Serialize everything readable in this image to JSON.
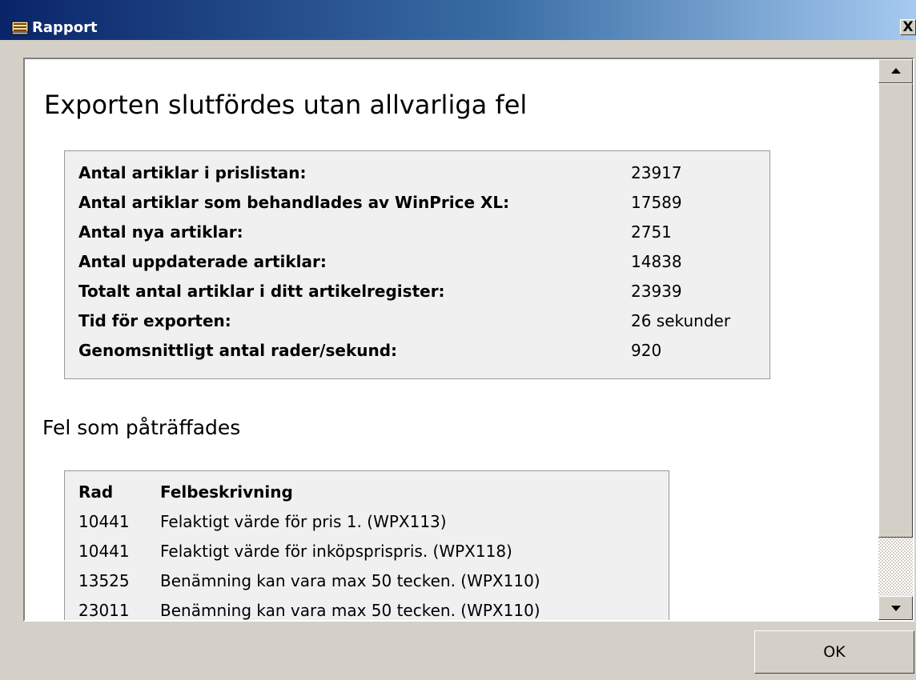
{
  "window": {
    "title": "Rapport",
    "close_label": "X"
  },
  "report": {
    "heading": "Exporten slutfördes utan allvarliga fel",
    "stats": [
      {
        "label": "Antal artiklar i prislistan:",
        "value": "23917"
      },
      {
        "label": "Antal artiklar som behandlades av WinPrice XL:",
        "value": "17589"
      },
      {
        "label": "Antal nya artiklar:",
        "value": "2751"
      },
      {
        "label": "Antal uppdaterade artiklar:",
        "value": "14838"
      },
      {
        "label": "Totalt antal artiklar i ditt artikelregister:",
        "value": "23939"
      },
      {
        "label": "Tid för exporten:",
        "value": "26 sekunder"
      },
      {
        "label": "Genomsnittligt antal rader/sekund:",
        "value": "920"
      }
    ],
    "errors_heading": "Fel som påträffades",
    "errors_columns": {
      "row": "Rad",
      "description": "Felbeskrivning"
    },
    "errors": [
      {
        "row": "10441",
        "description": "Felaktigt värde för pris 1. (WPX113)"
      },
      {
        "row": "10441",
        "description": "Felaktigt värde för inköpsprispris. (WPX118)"
      },
      {
        "row": "13525",
        "description": "Benämning kan vara max 50 tecken. (WPX110)"
      },
      {
        "row": "23011",
        "description": "Benämning kan vara max 50 tecken. (WPX110)"
      }
    ]
  },
  "footer": {
    "ok_label": "OK"
  }
}
